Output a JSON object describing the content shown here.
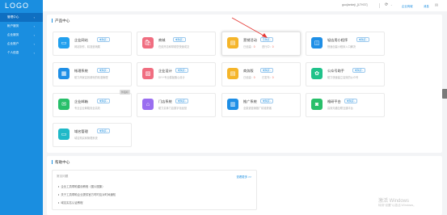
{
  "sidebar": {
    "logo": "LOGO",
    "items": [
      {
        "label": "管理中心",
        "chev": "‹"
      },
      {
        "label": "帐户服务",
        "chev": "‹"
      },
      {
        "label": "企业服务",
        "chev": "‹"
      },
      {
        "label": "企业账户",
        "chev": "‹"
      },
      {
        "label": "个人信息",
        "chev": "‹"
      }
    ]
  },
  "topbar": {
    "user": "guojiankeji_[LTH37]",
    "refresh_icon": "⟳",
    "refresh_chev": "⌄",
    "link1": "企业商城",
    "link2": "消息",
    "mail_icon": "✉"
  },
  "products": {
    "title": "产品中心",
    "cards": [
      {
        "name": "企业网站",
        "tag": "未购买 ›",
        "desc": "网站制作、精准营销展",
        "icon": "▭",
        "color": "#22a0ee"
      },
      {
        "name": "商城",
        "tag": "未购买 ›",
        "desc": "在线开店和帮助您快速成交",
        "icon": "🛍",
        "color": "#f06d80"
      },
      {
        "name": "营销活动",
        "tag": "已购买 ›",
        "stat1_label": "已创建：",
        "stat1_value": "0",
        "stat2_label": "进行中：",
        "stat2_value": "0",
        "icon": "▤",
        "color": "#f5b52a"
      },
      {
        "name": "轻店用小程序",
        "tag": "未购买 ›",
        "desc": "快速创建小程序入口解决",
        "icon": "◫",
        "color": "#1f8fe6"
      },
      {
        "name": "帐理系统",
        "tag": "未购买 ›",
        "desc": "助力商家高效便利的精准管理",
        "icon": "▦",
        "color": "#1f8fe6"
      },
      {
        "name": "企业设计",
        "tag": "未购买 ›",
        "desc": "DIY+专业模板随心设计",
        "icon": "▨",
        "color": "#f06d80"
      },
      {
        "name": "商务版",
        "tag": "未购买 ›",
        "stat1_label": "已创建：",
        "stat1_value": "0",
        "stat2_label": "已发布：",
        "stat2_value": "0",
        "icon": "▤",
        "color": "#f5b52a"
      },
      {
        "name": "公众号助手",
        "tag": "未购买 ›",
        "desc": "助力快速建立高效的公众号",
        "icon": "✿",
        "color": "#20c28a"
      },
      {
        "name": "企业邮箱",
        "tag": "未购买 ›",
        "desc": "专业企业邮箱安全高效",
        "icon": "✉",
        "color": "#28bf6a",
        "corner": "外链标"
      },
      {
        "name": "门店系统",
        "tag": "未购买 ›",
        "desc": "助力实体门店数字化经营",
        "icon": "⌂",
        "color": "#9a6ef0"
      },
      {
        "name": "推广系统",
        "tag": "未购买 ›",
        "desc": "全渠道营销推广精准获客",
        "icon": "▥",
        "color": "#1f8fe6"
      },
      {
        "name": "格研平台",
        "tag": "未购买 ›",
        "desc": "高效沟通互联互通平台",
        "icon": "◙",
        "color": "#28bf6a"
      },
      {
        "name": "域名管理",
        "tag": "未购买 ›",
        "desc": "域名购买和管理系统",
        "icon": "▭",
        "color": "#20b9c8"
      }
    ]
  },
  "help": {
    "title": "帮助中心",
    "head": "常见问题",
    "more": "查看更多 >>",
    "items": [
      "企业工具帮助建设教程（图片图集）",
      "关于工具帮助企业提供官方时时应对时间通知",
      "域名实名认证教程"
    ]
  },
  "watermark": {
    "line1": "激活 Windows",
    "line2": "转到“设置”以激活 Windows。"
  }
}
